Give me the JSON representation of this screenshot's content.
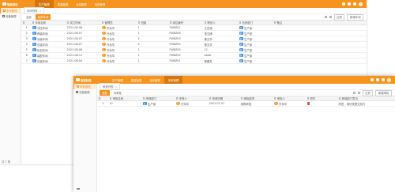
{
  "back": {
    "app_title": "智能制造",
    "menu": [
      {
        "label": "生产管理",
        "active": true
      },
      {
        "label": "质量管理",
        "active": false
      },
      {
        "label": "仓库管理",
        "active": false
      },
      {
        "label": "系统管理",
        "active": false
      }
    ],
    "sidebar": [
      {
        "label": "车间管理",
        "active": true
      },
      {
        "label": "设备管理",
        "active": false
      }
    ],
    "tab": "车间列表",
    "subtabs": [
      {
        "label": "全部",
        "active": false
      },
      {
        "label": "我的车间",
        "active": true
      }
    ],
    "toolbar": {
      "filter_label": "过滤",
      "add_label": "新增车间"
    },
    "columns": [
      "",
      "车间名称",
      "成立时间",
      "管理员",
      "班组",
      "岗位编号",
      "联系人",
      "负责部门",
      "备注"
    ],
    "rows": [
      {
        "c1": "冲压车间",
        "c2": "2021-06-08",
        "c3": "许永华",
        "c4": "1",
        "c5": "FW8Z01",
        "c6": "王志强",
        "c7": "生产部"
      },
      {
        "c1": "焊装车间",
        "c2": "2021-06-07",
        "c3": "许永华",
        "c4": "1",
        "c5": "FW8Z06",
        "c6": "李文博",
        "c7": "生产部"
      },
      {
        "c1": "涂装车间",
        "c2": "2021-06-07",
        "c3": "许永华",
        "c4": "2",
        "c5": "FW8Z03",
        "c6": "董文华",
        "c7": "生产部"
      },
      {
        "c1": "总装车间",
        "c2": "2021-06-07",
        "c3": "许永华",
        "c4": "4",
        "c5": "FW8Z04",
        "c6": "董文华",
        "c7": "生产部"
      },
      {
        "c1": "机加车间",
        "c2": "2021-06-06",
        "c3": "许永华",
        "c4": "1",
        "c5": "FW8Z05",
        "c6": "12",
        "c7": "生产部"
      },
      {
        "c1": "装配车间",
        "c2": "2021-06-11",
        "c3": "许永华",
        "c4": "1",
        "c5": "FW8Z02",
        "c6": "abda",
        "c7": "生产部"
      },
      {
        "c1": "包装车间",
        "c2": "2021-06-04",
        "c3": "许永华",
        "c4": "1",
        "c5": "FW8Z01",
        "c6": "董雅芳",
        "c7": "生产部"
      }
    ],
    "footer": "共 7 条"
  },
  "front": {
    "app_title": "智能制造",
    "menu": [
      {
        "label": "生产管理",
        "active": false
      },
      {
        "label": "质量管理",
        "active": false
      },
      {
        "label": "仓库管理",
        "active": false
      },
      {
        "label": "系统管理",
        "active": true
      }
    ],
    "sidebar": [
      {
        "label": "审批管理",
        "active": true
      },
      {
        "label": "流程管理",
        "active": false
      }
    ],
    "tab": "审批列表",
    "subtabs": [
      {
        "label": "全部",
        "active": true
      },
      {
        "label": "待审批",
        "active": false
      }
    ],
    "toolbar": {
      "filter_label": "过滤",
      "add_label": "新建审批"
    },
    "columns": [
      "",
      "审批名称",
      "申请部门",
      "申请人",
      "申请日期",
      "审批事项",
      "审批人",
      "附件",
      "其他部门意见"
    ],
    "rows": [
      {
        "c1": "12",
        "c2": "生产部",
        "c3": "许永华",
        "c4": "2021-07-07",
        "c5": "采购审批",
        "c6": "许永华",
        "c8": "同意，请尽快提交执行"
      }
    ]
  },
  "colors": {
    "brand": "#f7941d",
    "brand_dark": "#d8760c",
    "blue_badge": "#4a90d9",
    "attach_red": "#e0503c"
  }
}
